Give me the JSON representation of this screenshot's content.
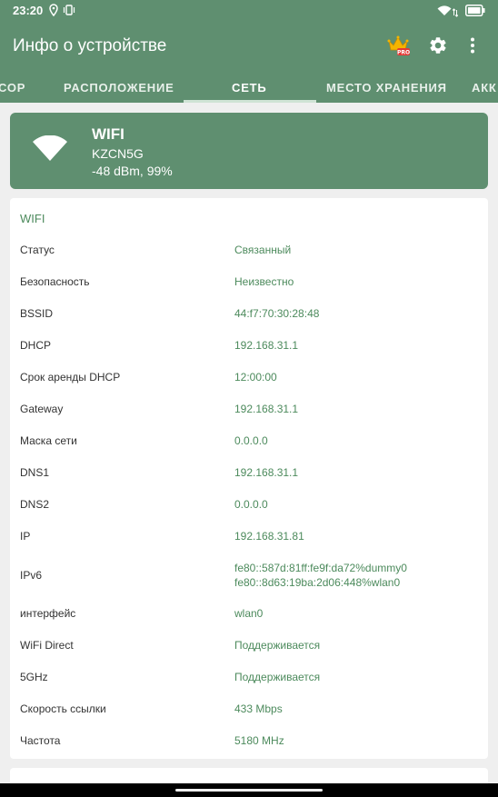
{
  "status_bar": {
    "time": "23:20",
    "icons": [
      "location-icon",
      "vibrate-icon",
      "wifi-icon",
      "battery-icon"
    ]
  },
  "app_bar": {
    "title": "Инфо о устройстве",
    "actions": [
      "pro-crown-icon",
      "settings-gear-icon",
      "more-vert-icon"
    ],
    "pro_badge": "PRO"
  },
  "tabs": [
    {
      "label": "СОР",
      "active": false
    },
    {
      "label": "РАСПОЛОЖЕНИЕ",
      "active": false
    },
    {
      "label": "СЕТЬ",
      "active": true
    },
    {
      "label": "МЕСТО ХРАНЕНИЯ",
      "active": false
    },
    {
      "label": "АКК",
      "active": false
    }
  ],
  "wifi_card": {
    "name": "WIFI",
    "ssid": "KZCN5G",
    "signal": "-48 dBm, 99%"
  },
  "details": {
    "section_title": "WIFI",
    "rows": [
      {
        "label": "Статус",
        "value": "Связанный"
      },
      {
        "label": "Безопасность",
        "value": "Неизвестно"
      },
      {
        "label": "BSSID",
        "value": "44:f7:70:30:28:48"
      },
      {
        "label": "DHCP",
        "value": "192.168.31.1"
      },
      {
        "label": "Срок аренды DHCP",
        "value": "12:00:00"
      },
      {
        "label": "Gateway",
        "value": "192.168.31.1"
      },
      {
        "label": "Маска сети",
        "value": "0.0.0.0"
      },
      {
        "label": "DNS1",
        "value": "192.168.31.1"
      },
      {
        "label": "DNS2",
        "value": "0.0.0.0"
      },
      {
        "label": "IP",
        "value": "192.168.31.81"
      },
      {
        "label": "IPv6",
        "value": "fe80::587d:81ff:fe9f:da72%dummy0",
        "value2": "fe80::8d63:19ba:2d06:448%wlan0"
      },
      {
        "label": "интерфейс",
        "value": "wlan0"
      },
      {
        "label": "WiFi Direct",
        "value": "Поддерживается"
      },
      {
        "label": "5GHz",
        "value": "Поддерживается"
      },
      {
        "label": "Скорость ссылки",
        "value": "433 Mbps"
      },
      {
        "label": "Частота",
        "value": "5180 MHz"
      }
    ]
  },
  "colors": {
    "primary": "#5f8f70",
    "accent_text": "#4c8a5c",
    "background": "#efefef",
    "card": "#ffffff"
  }
}
